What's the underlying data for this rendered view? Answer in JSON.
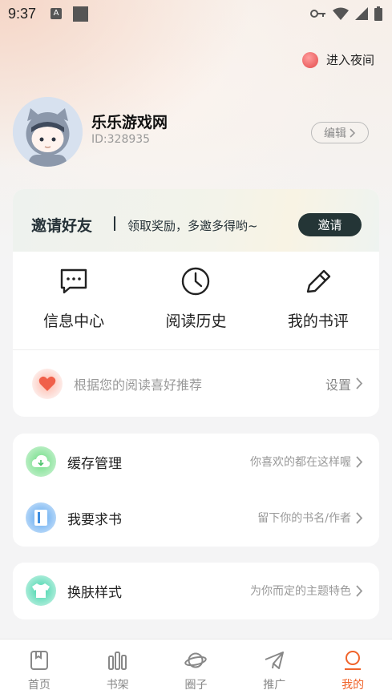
{
  "status_bar": {
    "time": "9:37",
    "a_icon": "A"
  },
  "night_mode": {
    "label": "进入夜间",
    "icon": "night-mode-icon"
  },
  "profile": {
    "username": "乐乐游戏网",
    "id_text": "ID:328935",
    "edit_label": "编辑"
  },
  "invite": {
    "title": "邀请好友",
    "subtitle": "领取奖励，多邀多得哟~",
    "button_label": "邀请"
  },
  "quick_actions": [
    {
      "label": "信息中心",
      "icon": "message-icon"
    },
    {
      "label": "阅读历史",
      "icon": "clock-icon"
    },
    {
      "label": "我的书评",
      "icon": "pen-icon"
    }
  ],
  "recommend": {
    "text": "根据您的阅读喜好推荐",
    "settings_label": "设置"
  },
  "menu_group_1": [
    {
      "label": "缓存管理",
      "sub": "你喜欢的都在这样喔",
      "icon": "download-cloud-icon",
      "color": "#4cc36b"
    },
    {
      "label": "我要求书",
      "sub": "留下你的书名/作者",
      "icon": "book-icon",
      "color": "#3d8ee0"
    }
  ],
  "menu_group_2": [
    {
      "label": "换肤样式",
      "sub": "为你而定的主题特色",
      "icon": "shirt-icon",
      "color": "#2ec49a"
    }
  ],
  "tabbar": {
    "items": [
      {
        "label": "首页",
        "icon": "home-icon"
      },
      {
        "label": "书架",
        "icon": "bookshelf-icon"
      },
      {
        "label": "圈子",
        "icon": "planet-icon"
      },
      {
        "label": "推广",
        "icon": "paper-plane-icon"
      },
      {
        "label": "我的",
        "icon": "profile-icon"
      }
    ],
    "active_index": 4,
    "active_color": "#f0632a"
  }
}
